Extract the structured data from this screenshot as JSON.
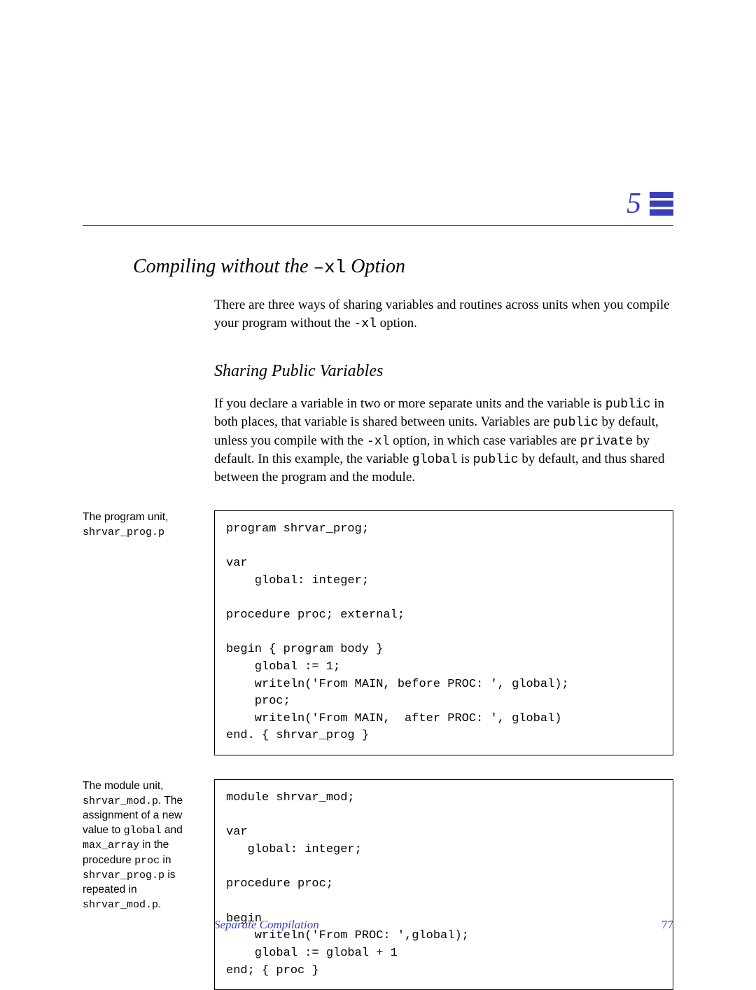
{
  "chapter_number": "5",
  "heading": {
    "pre": "Compiling without the ",
    "opt": "–xl",
    "post": " Option"
  },
  "intro": {
    "t1": "There are three ways of sharing variables and routines across units when you compile your program without the ",
    "opt": "-xl",
    "t2": " option."
  },
  "subheading": "Sharing Public Variables",
  "body": {
    "s1": "If you declare a variable in two or more separate units and the variable is ",
    "c1": "public",
    "s2": " in both places, that variable is shared between units.  Variables are ",
    "c2": "public",
    "s3": " by default, unless you compile with the ",
    "c3": "-xl",
    "s4": " option, in which case variables are ",
    "c4": "private",
    "s5": " by default.  In this example, the variable ",
    "c5": "global",
    "s6": " is ",
    "c6": "public",
    "s7": " by default, and thus shared between the program and the module."
  },
  "block1": {
    "note_pre": "The program unit,",
    "note_file": "shrvar_prog.p",
    "code": "program shrvar_prog;\n\nvar\n    global: integer;\n\nprocedure proc; external;\n\nbegin { program body }\n    global := 1;\n    writeln('From MAIN, before PROC: ', global);\n    proc;\n    writeln('From MAIN,  after PROC: ', global)\nend. { shrvar_prog }"
  },
  "block2": {
    "note": {
      "p1a": "The module unit, ",
      "p1b": "shrvar_mod.p",
      "p1c": ". The assignment of a new value to ",
      "p2a": "global",
      "p2b": " and ",
      "p2c": "max_array",
      "p2d": " in the procedure ",
      "p2e": "proc",
      "p2f": " in ",
      "p3a": "shrvar_prog.p",
      "p3b": " is repeated in ",
      "p4a": "shrvar_mod.p",
      "p4b": "."
    },
    "code": "module shrvar_mod;\n\nvar\n   global: integer;\n\nprocedure proc;\n\nbegin\n    writeln('From PROC: ',global);\n    global := global + 1\nend; { proc }"
  },
  "footer": {
    "title": "Separate Compilation",
    "page": "77"
  }
}
